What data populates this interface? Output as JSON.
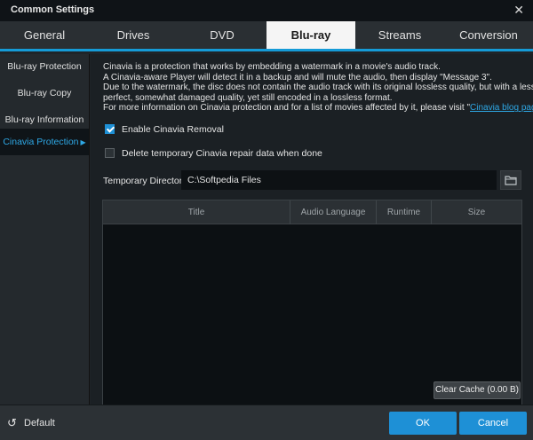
{
  "window": {
    "title": "Common Settings",
    "close_glyph": "✕",
    "close_icon": "close-icon"
  },
  "tabs": [
    {
      "label": "General"
    },
    {
      "label": "Drives"
    },
    {
      "label": "DVD"
    },
    {
      "label": "Blu-ray",
      "active": true
    },
    {
      "label": "Streams"
    },
    {
      "label": "Conversion"
    }
  ],
  "sidebar": {
    "items": [
      {
        "label": "Blu-ray Protection"
      },
      {
        "label": "Blu-ray Copy"
      },
      {
        "label": "Blu-ray Information"
      },
      {
        "label": "Cinavia Protection",
        "active": true,
        "arrow": "▶"
      }
    ]
  },
  "description": {
    "line1": "Cinavia is a protection that works by embedding a watermark in a movie's audio track.",
    "line2": "A Cinavia-aware Player will detect it in a backup and will mute the audio, then display \"Message 3\".",
    "line3": "Due to the watermark, the disc does not contain the audio track with its original lossless quality, but with a less than",
    "line4": "perfect, somewhat damaged quality, yet still encoded in a lossless format.",
    "line5_prefix": "For more information on Cinavia protection and for a list of movies affected by it, please visit \"",
    "link": "Cinavia blog page",
    "line5_suffix": "\"."
  },
  "options": {
    "enable_cinavia": {
      "label": "Enable Cinavia Removal",
      "checked": true
    },
    "delete_temp": {
      "label": "Delete temporary Cinavia repair data when done",
      "checked": false
    }
  },
  "temp_dir": {
    "label": "Temporary Directory",
    "value": "C:\\Softpedia Files",
    "folder_icon": "folder-icon"
  },
  "table": {
    "columns": [
      "Title",
      "Audio Language",
      "Runtime",
      "Size"
    ],
    "rows": []
  },
  "clear_cache": {
    "label": "Clear Cache (0.00 B)"
  },
  "footer": {
    "default_label": "Default",
    "reset_glyph": "↺",
    "ok_label": "OK",
    "cancel_label": "Cancel"
  },
  "colors": {
    "accent": "#1e90d6",
    "link": "#2ea8e6",
    "background": "#1f2428"
  }
}
